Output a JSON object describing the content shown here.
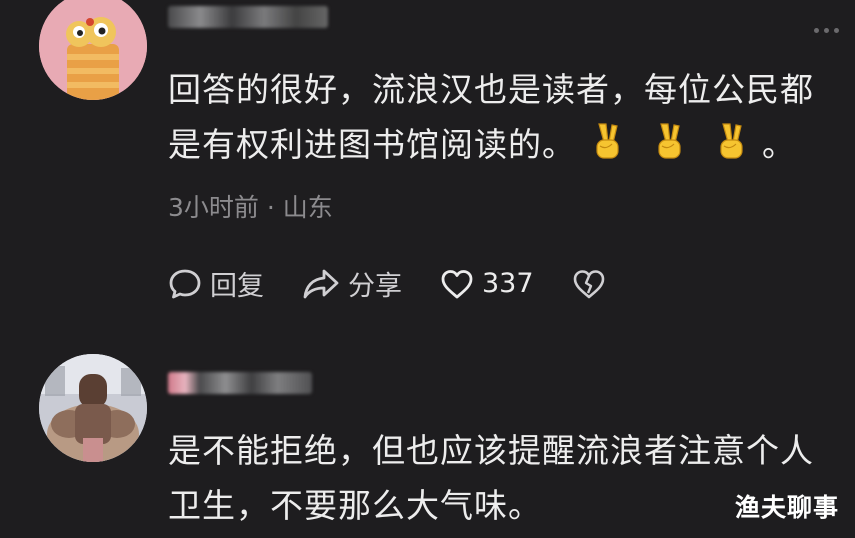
{
  "comments": [
    {
      "text_line1": "回答的很好，流浪汉也是读者，每位公民都",
      "text_line2": "是有权利进图书馆阅读的。",
      "text_line2_tail": "。",
      "emoji": "victory-hand-emoji",
      "time_location": "3小时前 · 山东",
      "reply_label": "回复",
      "share_label": "分享",
      "like_count": "337"
    },
    {
      "text_line1": "是不能拒绝，但也应该提醒流浪者注意个人",
      "text_line2": "卫生，不要那么大气味。"
    }
  ],
  "watermark": "渔夫聊事",
  "colors": {
    "background": "#1e1d1f",
    "text": "#ededed",
    "meta": "#8c8b8e",
    "avatar1_bg": "#e9a9b3",
    "emoji_yellow": "#f6c430"
  }
}
